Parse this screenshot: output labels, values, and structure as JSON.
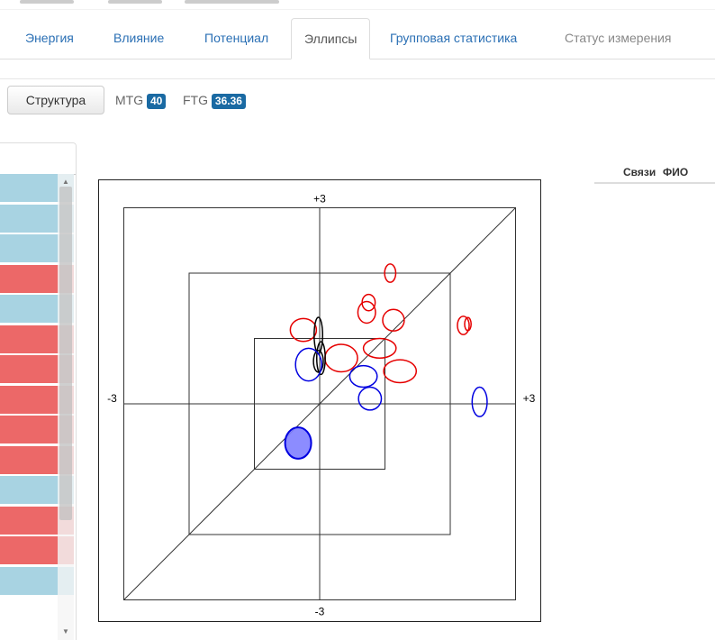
{
  "tabs": [
    {
      "label": "Энергия",
      "state": "link"
    },
    {
      "label": "Влияние",
      "state": "link"
    },
    {
      "label": "Потенциал",
      "state": "link"
    },
    {
      "label": "Эллипсы",
      "state": "active"
    },
    {
      "label": "Групповая статистика",
      "state": "link"
    },
    {
      "label": "Статус измерения",
      "state": "disabled"
    }
  ],
  "toolbar": {
    "structure_label": "Структура",
    "mtg_label": "MTG",
    "mtg_value": "40",
    "ftg_label": "FTG",
    "ftg_value": "36.36"
  },
  "right_table": {
    "columns": [
      "Связи",
      "ФИО"
    ]
  },
  "left_table": {
    "row_colors": [
      "blue",
      "blue",
      "blue",
      "red",
      "blue",
      "red",
      "red",
      "red",
      "red",
      "red",
      "blue",
      "red",
      "red",
      "blue"
    ]
  },
  "colors": {
    "accent": "#2a6fb4",
    "badge": "#1a6aa3",
    "row_blue": "#a8d3e2",
    "row_red": "#ec6868",
    "ellipse_red": "#e60000",
    "ellipse_blue": "#0000e0",
    "ellipse_black": "#000000"
  },
  "chart_data": {
    "type": "scatter",
    "axis_labels": {
      "top": "+3",
      "bottom": "-3",
      "left": "-3",
      "right": "+3"
    },
    "xlim": [
      -3,
      3
    ],
    "ylim": [
      -3,
      3
    ],
    "guide_squares": [
      1,
      2,
      3
    ],
    "diagonal": true,
    "ellipses": [
      {
        "color": "red",
        "x": 2.2,
        "y": 1.2,
        "rx": 0.18,
        "ry": 0.28
      },
      {
        "color": "red",
        "x": 2.27,
        "y": 1.22,
        "rx": 0.1,
        "ry": 0.2
      },
      {
        "color": "red",
        "x": 1.08,
        "y": 2.0,
        "rx": 0.17,
        "ry": 0.28
      },
      {
        "color": "red",
        "x": 0.75,
        "y": 1.55,
        "rx": 0.2,
        "ry": 0.25
      },
      {
        "color": "red",
        "x": 0.72,
        "y": 1.4,
        "rx": 0.27,
        "ry": 0.33
      },
      {
        "color": "red",
        "x": 1.13,
        "y": 1.28,
        "rx": 0.33,
        "ry": 0.33
      },
      {
        "color": "red",
        "x": -0.25,
        "y": 1.13,
        "rx": 0.4,
        "ry": 0.35
      },
      {
        "color": "red",
        "x": 0.92,
        "y": 0.85,
        "rx": 0.5,
        "ry": 0.3
      },
      {
        "color": "red",
        "x": 0.33,
        "y": 0.7,
        "rx": 0.5,
        "ry": 0.42
      },
      {
        "color": "red",
        "x": 1.23,
        "y": 0.5,
        "rx": 0.5,
        "ry": 0.35
      },
      {
        "color": "black",
        "x": -0.02,
        "y": 1.05,
        "rx": 0.13,
        "ry": 0.55
      },
      {
        "color": "black",
        "x": 0.02,
        "y": 0.7,
        "rx": 0.13,
        "ry": 0.5
      },
      {
        "color": "black",
        "x": -0.02,
        "y": 0.65,
        "rx": 0.15,
        "ry": 0.33
      },
      {
        "color": "blue",
        "x": -0.17,
        "y": 0.6,
        "rx": 0.4,
        "ry": 0.5
      },
      {
        "color": "blue",
        "x": 0.67,
        "y": 0.42,
        "rx": 0.42,
        "ry": 0.33
      },
      {
        "color": "blue",
        "x": 0.77,
        "y": 0.08,
        "rx": 0.35,
        "ry": 0.35
      },
      {
        "color": "blue",
        "x": 2.45,
        "y": 0.03,
        "rx": 0.23,
        "ry": 0.45
      },
      {
        "color": "blue",
        "x": -0.33,
        "y": -0.6,
        "rx": 0.4,
        "ry": 0.48,
        "filled": true
      }
    ]
  }
}
